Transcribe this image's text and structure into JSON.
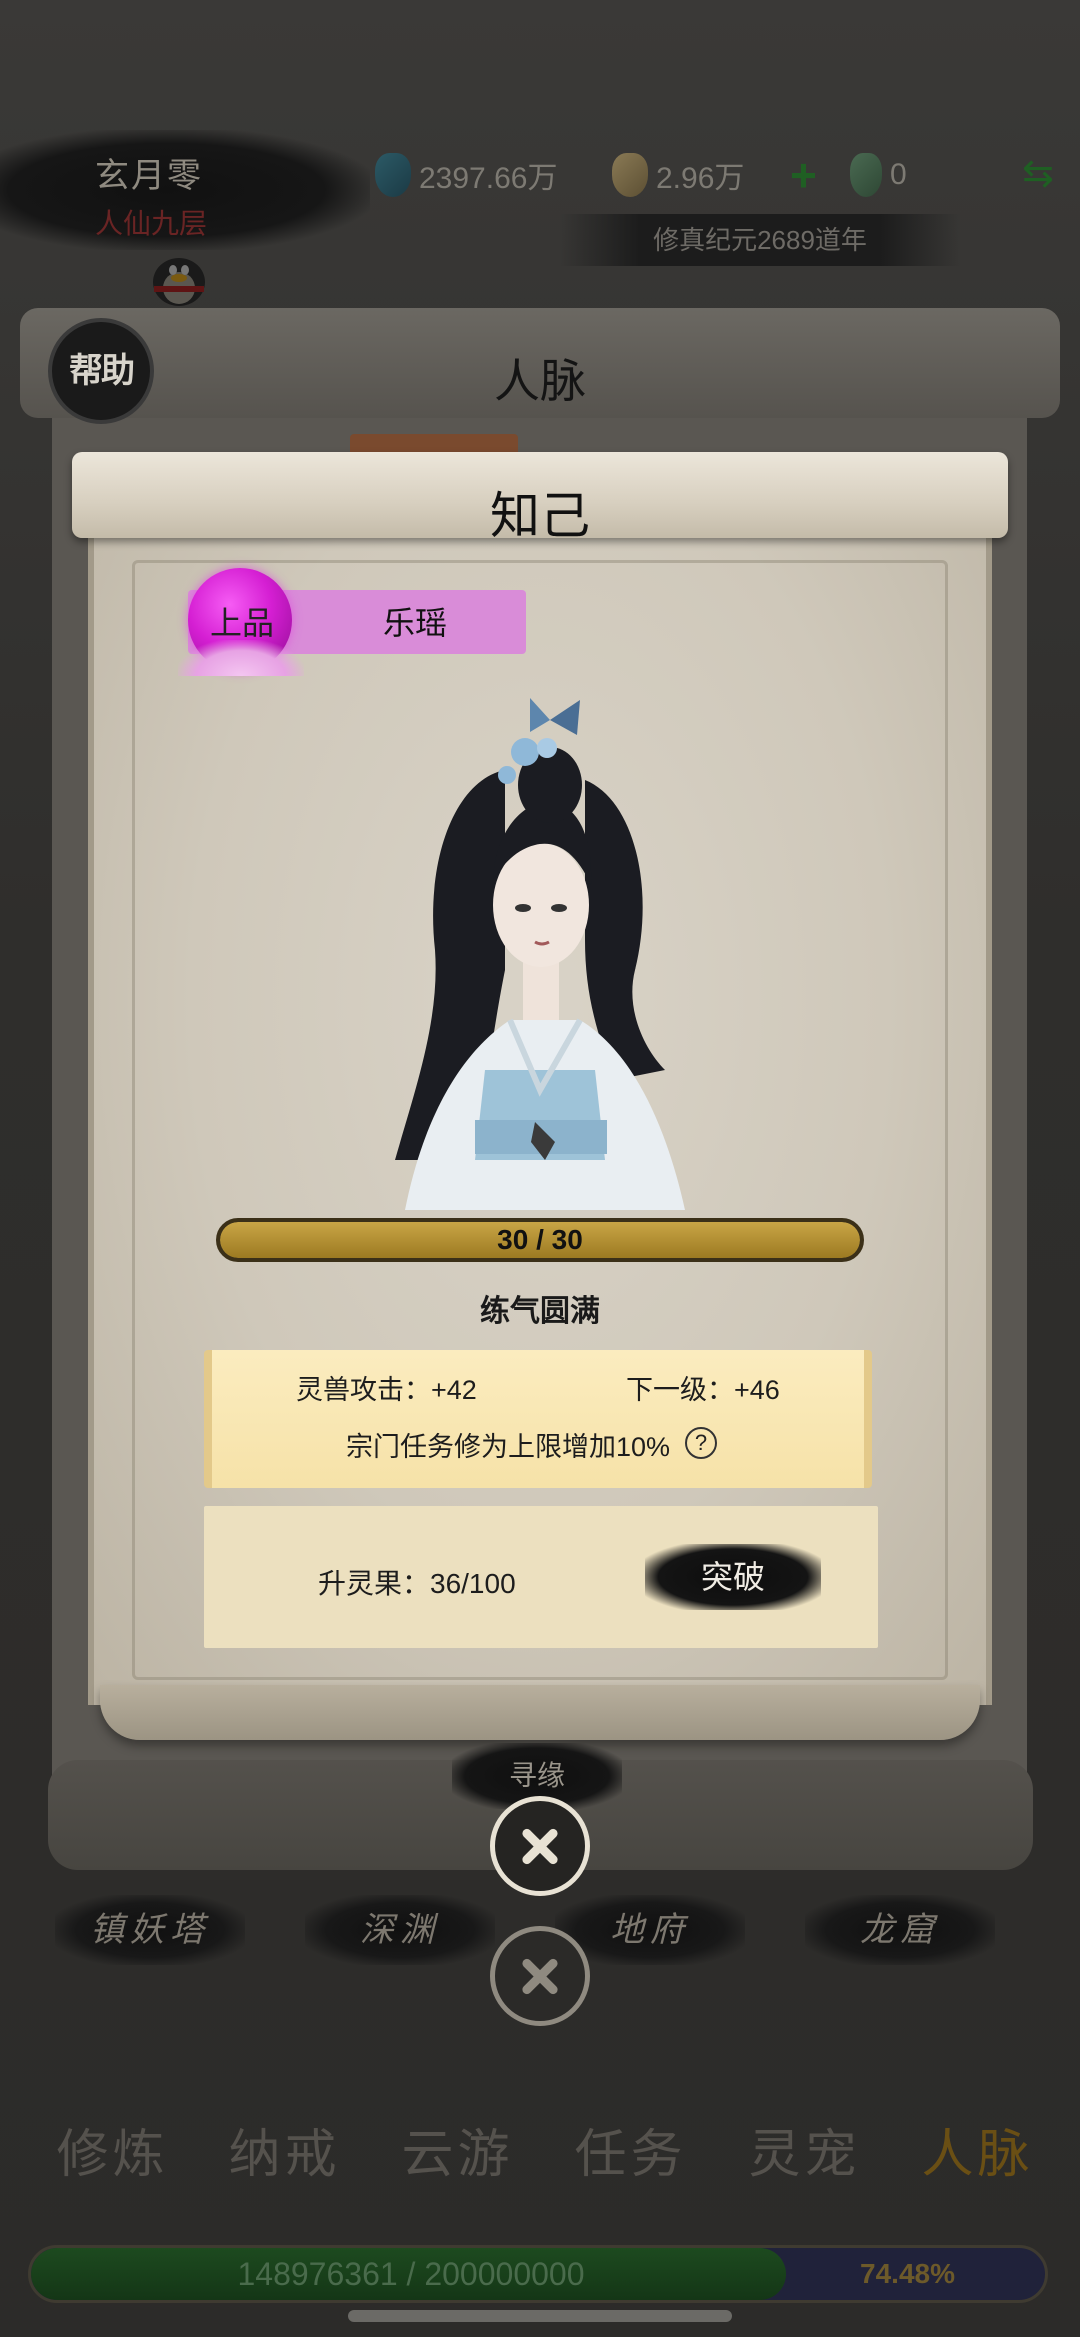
{
  "header": {
    "player_name": "玄月零",
    "player_realm": "人仙九层",
    "spirit_stones": "2397.66万",
    "gold": "2.96万",
    "jade": "0",
    "era": "修真纪元2689道年",
    "icons": {
      "spirit_stone": "spirit-stone-icon",
      "gold": "gold-ingot-icon",
      "jade": "jade-icon",
      "add": "plus-icon",
      "swap": "swap-arrows-icon"
    }
  },
  "back_panel": {
    "help_label": "帮助",
    "title": "人脉",
    "seek_button": "寻缘",
    "map_buttons": [
      "镇妖塔",
      "深渊",
      "地府",
      "龙窟"
    ]
  },
  "dialog": {
    "title": "知己",
    "grade": "上品",
    "name": "乐瑶",
    "progress": {
      "current": 30,
      "max": 30,
      "text": "30 / 30"
    },
    "realm": "练气圆满",
    "attr_current": "灵兽攻击：+42",
    "attr_next": "下一级：+46",
    "bonus": "宗门任务修为上限增加10%",
    "fruit": "升灵果：36/100",
    "breakthrough_button": "突破"
  },
  "bottom_nav": {
    "items": [
      "修炼",
      "纳戒",
      "云游",
      "任务",
      "灵宠",
      "人脉"
    ],
    "active": "人脉"
  },
  "exp": {
    "text": "148976361 / 200000000",
    "percent": "74.48%",
    "fraction": 0.7448
  },
  "colors": {
    "grade_purple": "#d98cd8",
    "progress_gold": "#b8952f",
    "exp_green": "#1d4a1f",
    "card_yellow": "#f8e7b4"
  }
}
